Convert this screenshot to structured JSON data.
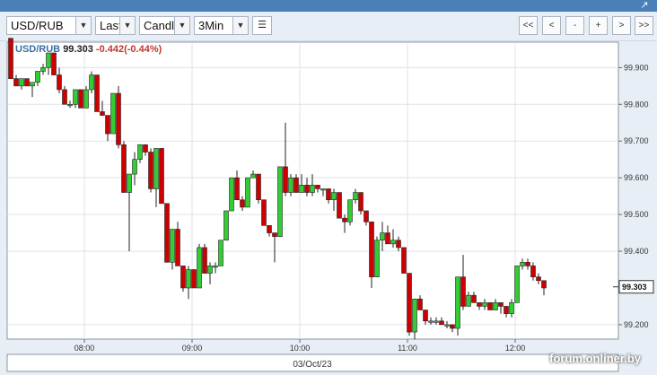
{
  "toolbar": {
    "symbol": "USD/RUB",
    "price_type": "Last",
    "chart_type": "Candle",
    "interval": "3Min",
    "nav": [
      "<<",
      "<",
      "-",
      "+",
      ">",
      ">>"
    ]
  },
  "legend": {
    "symbol": "USD/RUB",
    "price": "99.303",
    "change": "-0.442(-0.44%)"
  },
  "watermark": "forum.onliner.by",
  "colors": {
    "up": "#33cc33",
    "down": "#cc0000",
    "grid": "#dde3ea",
    "frame": "#8a94a0"
  },
  "chart_data": {
    "type": "candlestick",
    "date_label": "03/Oct/23",
    "x_ticks": [
      "08:00",
      "09:00",
      "10:00",
      "11:00",
      "12:00"
    ],
    "y_ticks": [
      "99.900",
      "99.800",
      "99.700",
      "99.600",
      "99.500",
      "99.400",
      "99.200"
    ],
    "y_tick_values": [
      99.9,
      99.8,
      99.7,
      99.6,
      99.5,
      99.4,
      99.2
    ],
    "current_price": "99.303",
    "current_value": 99.303,
    "ylim": [
      99.19,
      99.94
    ],
    "candles": [
      [
        99.98,
        99.98,
        99.87,
        99.87
      ],
      [
        99.87,
        99.88,
        99.85,
        99.85
      ],
      [
        99.85,
        99.87,
        99.84,
        99.87
      ],
      [
        99.87,
        99.87,
        99.85,
        99.85
      ],
      [
        99.85,
        99.86,
        99.82,
        99.86
      ],
      [
        99.86,
        99.89,
        99.85,
        99.89
      ],
      [
        99.89,
        99.91,
        99.88,
        99.9
      ],
      [
        99.9,
        99.94,
        99.88,
        99.94
      ],
      [
        99.94,
        99.94,
        99.88,
        99.88
      ],
      [
        99.88,
        99.9,
        99.83,
        99.84
      ],
      [
        99.84,
        99.85,
        99.8,
        99.8
      ],
      [
        99.8,
        99.81,
        99.79,
        99.8
      ],
      [
        99.8,
        99.84,
        99.79,
        99.84
      ],
      [
        99.84,
        99.84,
        99.79,
        99.79
      ],
      [
        99.79,
        99.85,
        99.79,
        99.84
      ],
      [
        99.84,
        99.89,
        99.83,
        99.88
      ],
      [
        99.88,
        99.88,
        99.78,
        99.78
      ],
      [
        99.78,
        99.81,
        99.77,
        99.77
      ],
      [
        99.77,
        99.77,
        99.7,
        99.72
      ],
      [
        99.72,
        99.83,
        99.72,
        99.83
      ],
      [
        99.83,
        99.85,
        99.68,
        99.69
      ],
      [
        99.69,
        99.7,
        99.57,
        99.56
      ],
      [
        99.56,
        99.61,
        99.4,
        99.61
      ],
      [
        99.61,
        99.67,
        99.58,
        99.65
      ],
      [
        99.65,
        99.69,
        99.64,
        99.69
      ],
      [
        99.69,
        99.69,
        99.66,
        99.67
      ],
      [
        99.67,
        99.68,
        99.56,
        99.57
      ],
      [
        99.57,
        99.68,
        99.52,
        99.68
      ],
      [
        99.68,
        99.68,
        99.53,
        99.53
      ],
      [
        99.53,
        99.53,
        99.37,
        99.37
      ],
      [
        99.37,
        99.45,
        99.35,
        99.46
      ],
      [
        99.46,
        99.48,
        99.36,
        99.36
      ],
      [
        99.36,
        99.36,
        99.29,
        99.3
      ],
      [
        99.3,
        99.36,
        99.27,
        99.35
      ],
      [
        99.35,
        99.35,
        99.3,
        99.3
      ],
      [
        99.3,
        99.42,
        99.3,
        99.41
      ],
      [
        99.41,
        99.42,
        99.34,
        99.34
      ],
      [
        99.34,
        99.37,
        99.31,
        99.36
      ],
      [
        99.36,
        99.37,
        99.34,
        99.36
      ],
      [
        99.36,
        99.43,
        99.36,
        99.43
      ],
      [
        99.43,
        99.51,
        99.43,
        99.51
      ],
      [
        99.51,
        99.6,
        99.51,
        99.6
      ],
      [
        99.6,
        99.62,
        99.54,
        99.54
      ],
      [
        99.54,
        99.55,
        99.51,
        99.52
      ],
      [
        99.52,
        99.6,
        99.52,
        99.6
      ],
      [
        99.6,
        99.62,
        99.6,
        99.61
      ],
      [
        99.61,
        99.61,
        99.53,
        99.54
      ],
      [
        99.54,
        99.54,
        99.47,
        99.47
      ],
      [
        99.47,
        99.47,
        99.44,
        99.45
      ],
      [
        99.45,
        99.45,
        99.37,
        99.44
      ],
      [
        99.44,
        99.63,
        99.44,
        99.63
      ],
      [
        99.63,
        99.75,
        99.55,
        99.56
      ],
      [
        99.56,
        99.61,
        99.55,
        99.6
      ],
      [
        99.6,
        99.61,
        99.56,
        99.56
      ],
      [
        99.56,
        99.61,
        99.56,
        99.58
      ],
      [
        99.58,
        99.6,
        99.55,
        99.56
      ],
      [
        99.56,
        99.61,
        99.55,
        99.58
      ],
      [
        99.58,
        99.58,
        99.56,
        99.57
      ],
      [
        99.57,
        99.57,
        99.55,
        99.57
      ],
      [
        99.57,
        99.57,
        99.53,
        99.54
      ],
      [
        99.54,
        99.57,
        99.51,
        99.56
      ],
      [
        99.56,
        99.56,
        99.49,
        99.49
      ],
      [
        99.49,
        99.5,
        99.45,
        99.48
      ],
      [
        99.48,
        99.54,
        99.47,
        99.54
      ],
      [
        99.54,
        99.57,
        99.53,
        99.56
      ],
      [
        99.56,
        99.56,
        99.5,
        99.51
      ],
      [
        99.51,
        99.51,
        99.47,
        99.48
      ],
      [
        99.48,
        99.48,
        99.3,
        99.33
      ],
      [
        99.33,
        99.44,
        99.33,
        99.43
      ],
      [
        99.43,
        99.48,
        99.4,
        99.45
      ],
      [
        99.45,
        99.47,
        99.42,
        99.42
      ],
      [
        99.42,
        99.46,
        99.41,
        99.43
      ],
      [
        99.43,
        99.44,
        99.4,
        99.41
      ],
      [
        99.41,
        99.41,
        99.34,
        99.34
      ],
      [
        99.34,
        99.34,
        99.17,
        99.18
      ],
      [
        99.18,
        99.27,
        99.16,
        99.27
      ],
      [
        99.27,
        99.28,
        99.24,
        99.24
      ],
      [
        99.24,
        99.24,
        99.2,
        99.21
      ],
      [
        99.21,
        99.22,
        99.2,
        99.21
      ],
      [
        99.21,
        99.22,
        99.2,
        99.21
      ],
      [
        99.21,
        99.22,
        99.2,
        99.2
      ],
      [
        99.2,
        99.21,
        99.19,
        99.2
      ],
      [
        99.2,
        99.2,
        99.18,
        99.19
      ],
      [
        99.19,
        99.33,
        99.17,
        99.33
      ],
      [
        99.33,
        99.39,
        99.24,
        99.25
      ],
      [
        99.25,
        99.29,
        99.25,
        99.28
      ],
      [
        99.28,
        99.29,
        99.26,
        99.26
      ],
      [
        99.26,
        99.26,
        99.24,
        99.25
      ],
      [
        99.25,
        99.27,
        99.24,
        99.26
      ],
      [
        99.26,
        99.26,
        99.24,
        99.24
      ],
      [
        99.24,
        99.27,
        99.24,
        99.26
      ],
      [
        99.26,
        99.26,
        99.23,
        99.25
      ],
      [
        99.25,
        99.25,
        99.22,
        99.23
      ],
      [
        99.23,
        99.27,
        99.22,
        99.26
      ],
      [
        99.26,
        99.36,
        99.26,
        99.36
      ],
      [
        99.36,
        99.38,
        99.35,
        99.37
      ],
      [
        99.37,
        99.38,
        99.35,
        99.36
      ],
      [
        99.36,
        99.37,
        99.32,
        99.33
      ],
      [
        99.33,
        99.34,
        99.31,
        99.32
      ],
      [
        99.32,
        99.32,
        99.28,
        99.3
      ]
    ]
  }
}
